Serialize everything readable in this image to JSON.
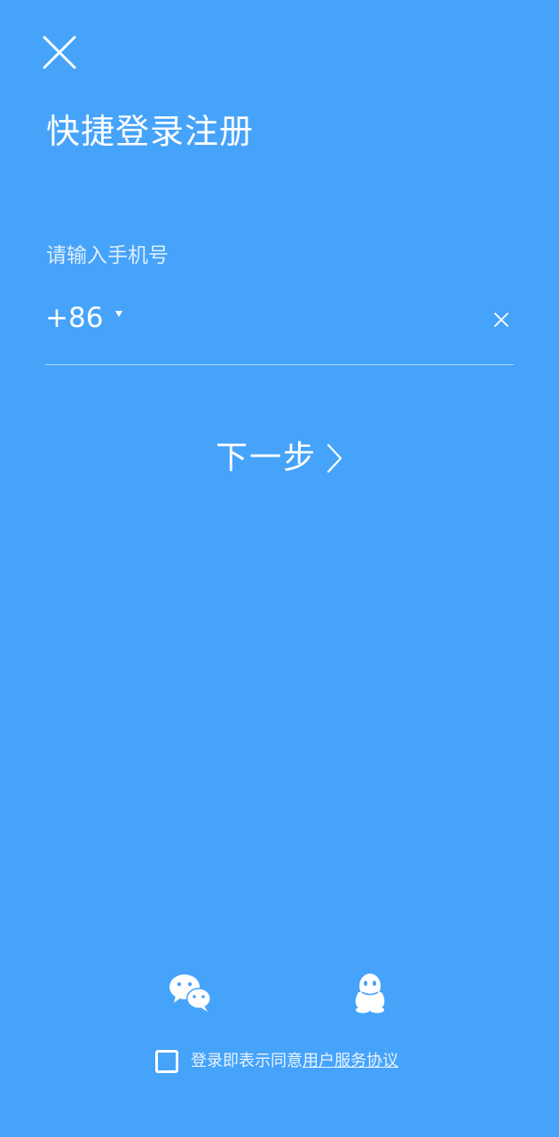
{
  "header": {
    "title": "快捷登录注册",
    "close_icon": "close-icon"
  },
  "phone": {
    "label": "请输入手机号",
    "country_code": "+86",
    "value": "",
    "placeholder": "",
    "clear_icon": "close-icon"
  },
  "actions": {
    "next_label": "下一步",
    "next_icon": "chevron-right-icon"
  },
  "social": {
    "items": [
      {
        "name": "wechat",
        "icon": "wechat-icon"
      },
      {
        "name": "qq",
        "icon": "qq-icon"
      }
    ]
  },
  "agreement": {
    "checked": false,
    "text": "登录即表示同意",
    "link_text": "用户服务协议"
  },
  "colors": {
    "background": "#46a3fa",
    "foreground": "#ffffff"
  }
}
